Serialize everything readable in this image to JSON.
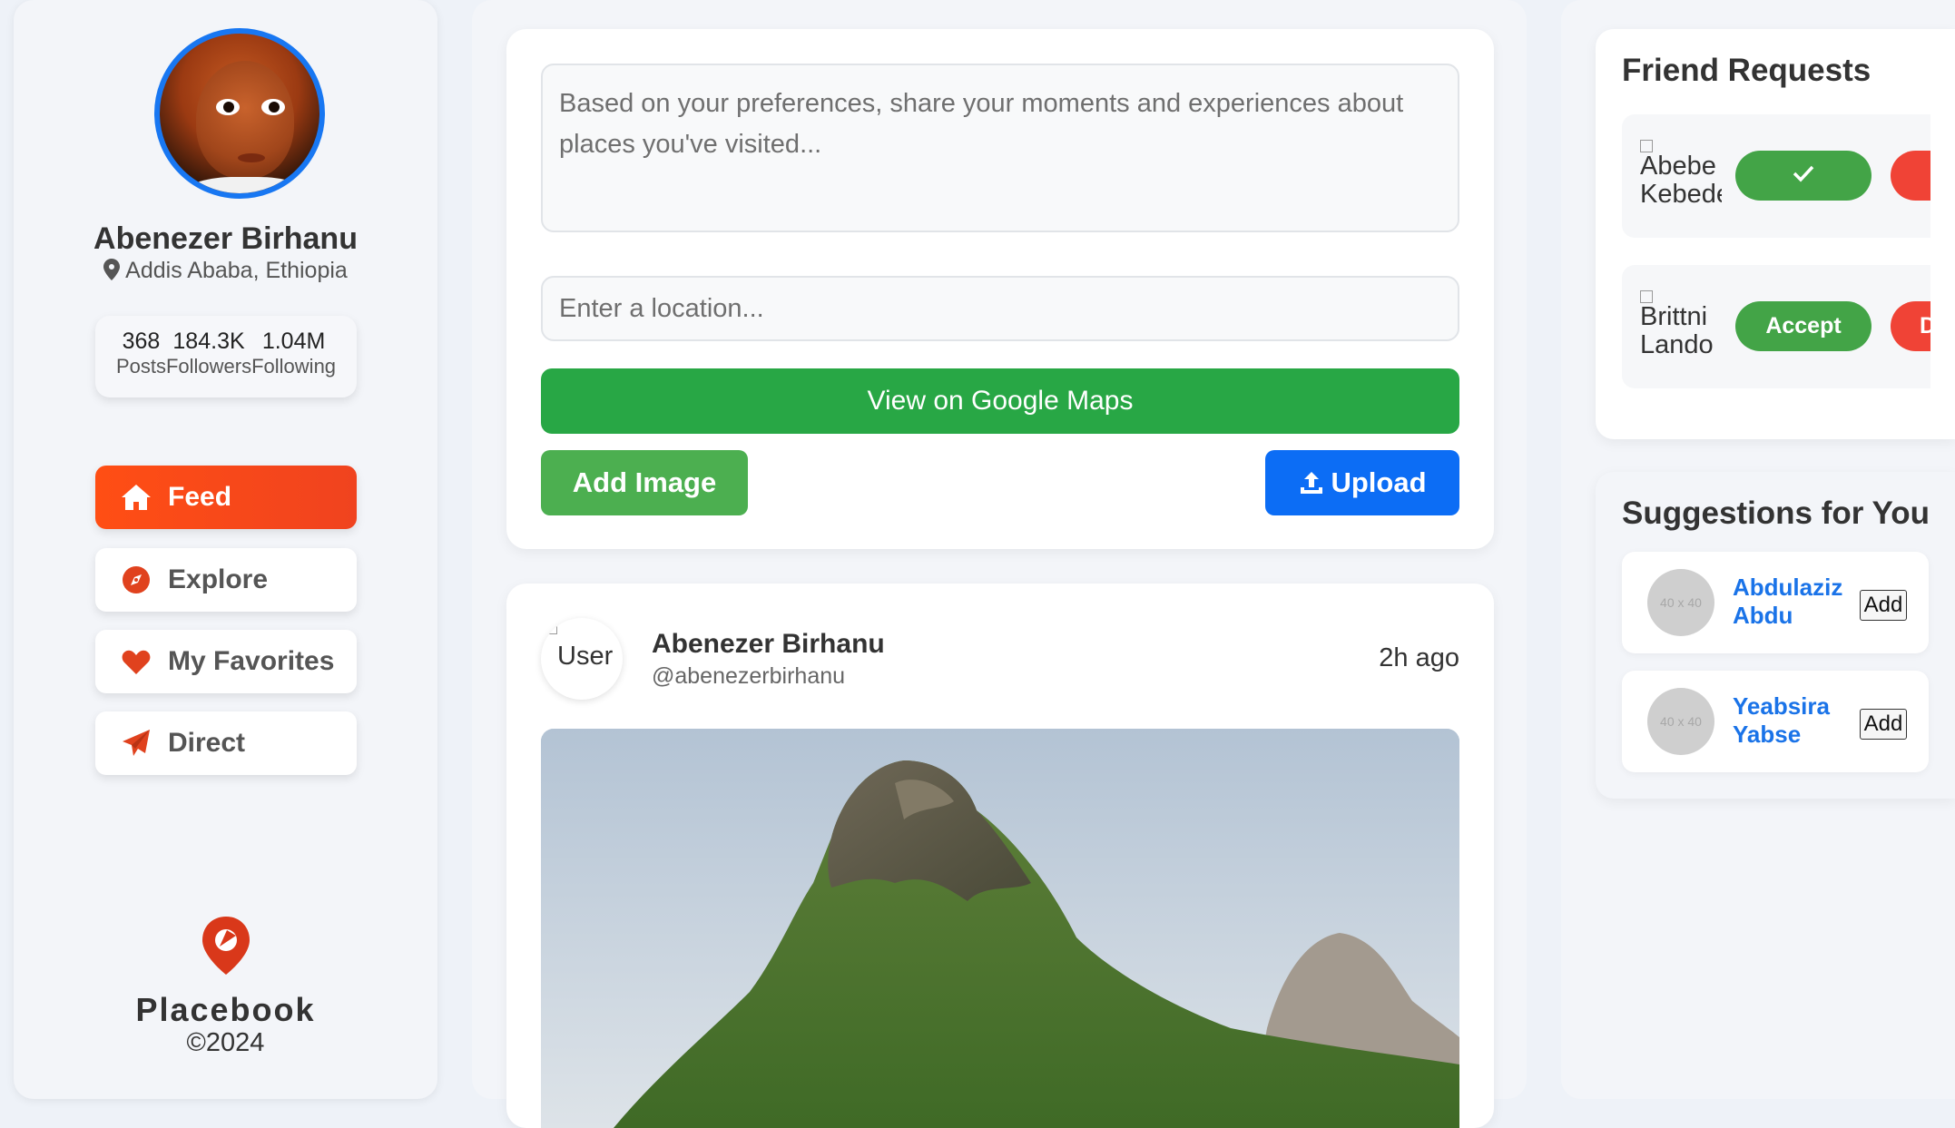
{
  "profile": {
    "name": "Abenezer Birhanu",
    "location": "Addis Ababa, Ethiopia",
    "stats": [
      {
        "value": "368",
        "label": "Posts"
      },
      {
        "value": "184.3K",
        "label": "Followers"
      },
      {
        "value": "1.04M",
        "label": "Following"
      }
    ]
  },
  "nav": {
    "items": [
      {
        "label": "Feed",
        "icon": "home-icon",
        "active": true
      },
      {
        "label": "Explore",
        "icon": "compass-icon"
      },
      {
        "label": "My Favorites",
        "icon": "heart-icon"
      },
      {
        "label": "Direct",
        "icon": "paper-plane-icon"
      }
    ]
  },
  "brand": {
    "name": "Placebook",
    "copyright": "©2024"
  },
  "composer": {
    "text_placeholder": "Based on your preferences, share your moments and experiences about places you've visited...",
    "location_placeholder": "Enter a location...",
    "maps_label": "View on Google Maps",
    "add_image_label": "Add Image",
    "upload_label": "Upload"
  },
  "post": {
    "avatar_alt": "User",
    "author": "Abenezer Birhanu",
    "handle": "@abenezerbirhanu",
    "time": "2h ago"
  },
  "friend_requests": {
    "title": "Friend Requests",
    "items": [
      {
        "name_alt": "Abebe Kebede",
        "accept_label": "✓",
        "decline_label": ""
      },
      {
        "name_alt": "Brittni Lando",
        "accept_label": "Accept",
        "decline_label": "D"
      }
    ]
  },
  "suggestions": {
    "title": "Suggestions for You",
    "items": [
      {
        "avatar_text": "40 x 40",
        "name": "Abdulaziz Abdu",
        "add_label": "Add"
      },
      {
        "avatar_text": "40 x 40",
        "name": "Yeabsira Yabse",
        "add_label": "Add"
      }
    ]
  },
  "colors": {
    "accent": "#f0431f",
    "primary_blue": "#0c6df5",
    "green": "#28a745",
    "danger": "#f04336"
  }
}
